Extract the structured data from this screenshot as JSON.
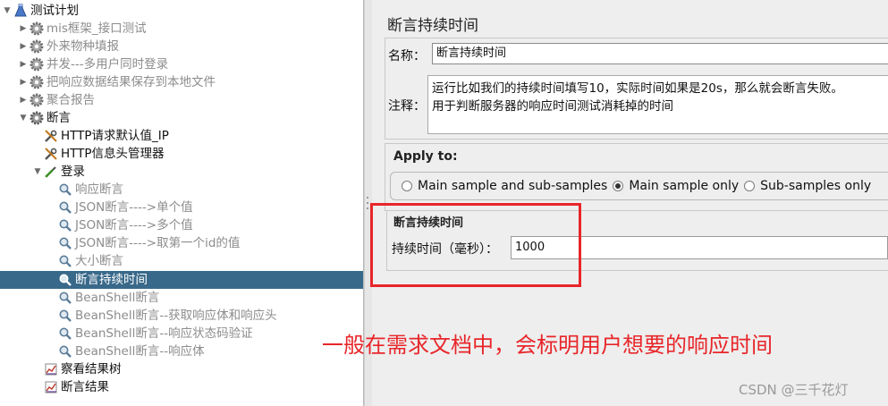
{
  "tree": {
    "root": {
      "label": "测试计划"
    },
    "items": [
      {
        "label": "mis框架_接口测试",
        "icon": "gear-icon",
        "disabled": true
      },
      {
        "label": "外来物种填报",
        "icon": "gear-icon",
        "disabled": true
      },
      {
        "label": "并发---多用户同时登录",
        "icon": "gear-icon",
        "disabled": true
      },
      {
        "label": "把响应数据结果保存到本地文件",
        "icon": "gear-icon",
        "disabled": true
      },
      {
        "label": "聚合报告",
        "icon": "gear-icon",
        "disabled": true
      },
      {
        "label": "断言",
        "icon": "gear-icon",
        "disabled": false
      }
    ],
    "assert_children": [
      {
        "label": "HTTP请求默认值_IP",
        "icon": "wrench-icon"
      },
      {
        "label": "HTTP信息头管理器",
        "icon": "wrench-icon"
      },
      {
        "label": "登录",
        "icon": "pipette-icon"
      }
    ],
    "login_children": [
      {
        "label": "响应断言",
        "disabled": true
      },
      {
        "label": "JSON断言---->单个值",
        "disabled": true
      },
      {
        "label": "JSON断言---->多个值",
        "disabled": true
      },
      {
        "label": "JSON断言---->取第一个id的值",
        "disabled": true
      },
      {
        "label": "大小断言",
        "disabled": true
      },
      {
        "label": "断言持续时间",
        "disabled": false,
        "selected": true
      },
      {
        "label": "BeanShell断言",
        "disabled": true
      },
      {
        "label": "BeanShell断言--获取响应体和响应头",
        "disabled": true
      },
      {
        "label": "BeanShell断言--响应状态码验证",
        "disabled": true
      },
      {
        "label": "BeanShell断言--响应体",
        "disabled": true
      }
    ],
    "listeners": [
      {
        "label": "察看结果树",
        "icon": "chart-icon"
      },
      {
        "label": "断言结果",
        "icon": "chart-icon"
      }
    ]
  },
  "panel": {
    "title": "断言持续时间",
    "name_label": "名称：",
    "name_value": "断言持续时间",
    "note_label": "注释：",
    "note_line1": "运行比如我们的持续时间填写10，实际时间如果是20s，那么就会断言失败。",
    "note_line2": "用于判断服务器的响应时间测试消耗掉的时间",
    "apply_to": {
      "title": "Apply to:",
      "options": [
        "Main sample and sub-samples",
        "Main sample only",
        "Sub-samples only"
      ],
      "selected": "Main sample only"
    },
    "duration": {
      "section_title": "断言持续时间",
      "label": "持续时间（毫秒）：",
      "value": "1000"
    }
  },
  "annotation": "一般在需求文档中，会标明用户想要的响应时间",
  "watermark": "CSDN @三千花灯",
  "colors": {
    "selection": "#39698a",
    "annotation": "#e8262a"
  }
}
